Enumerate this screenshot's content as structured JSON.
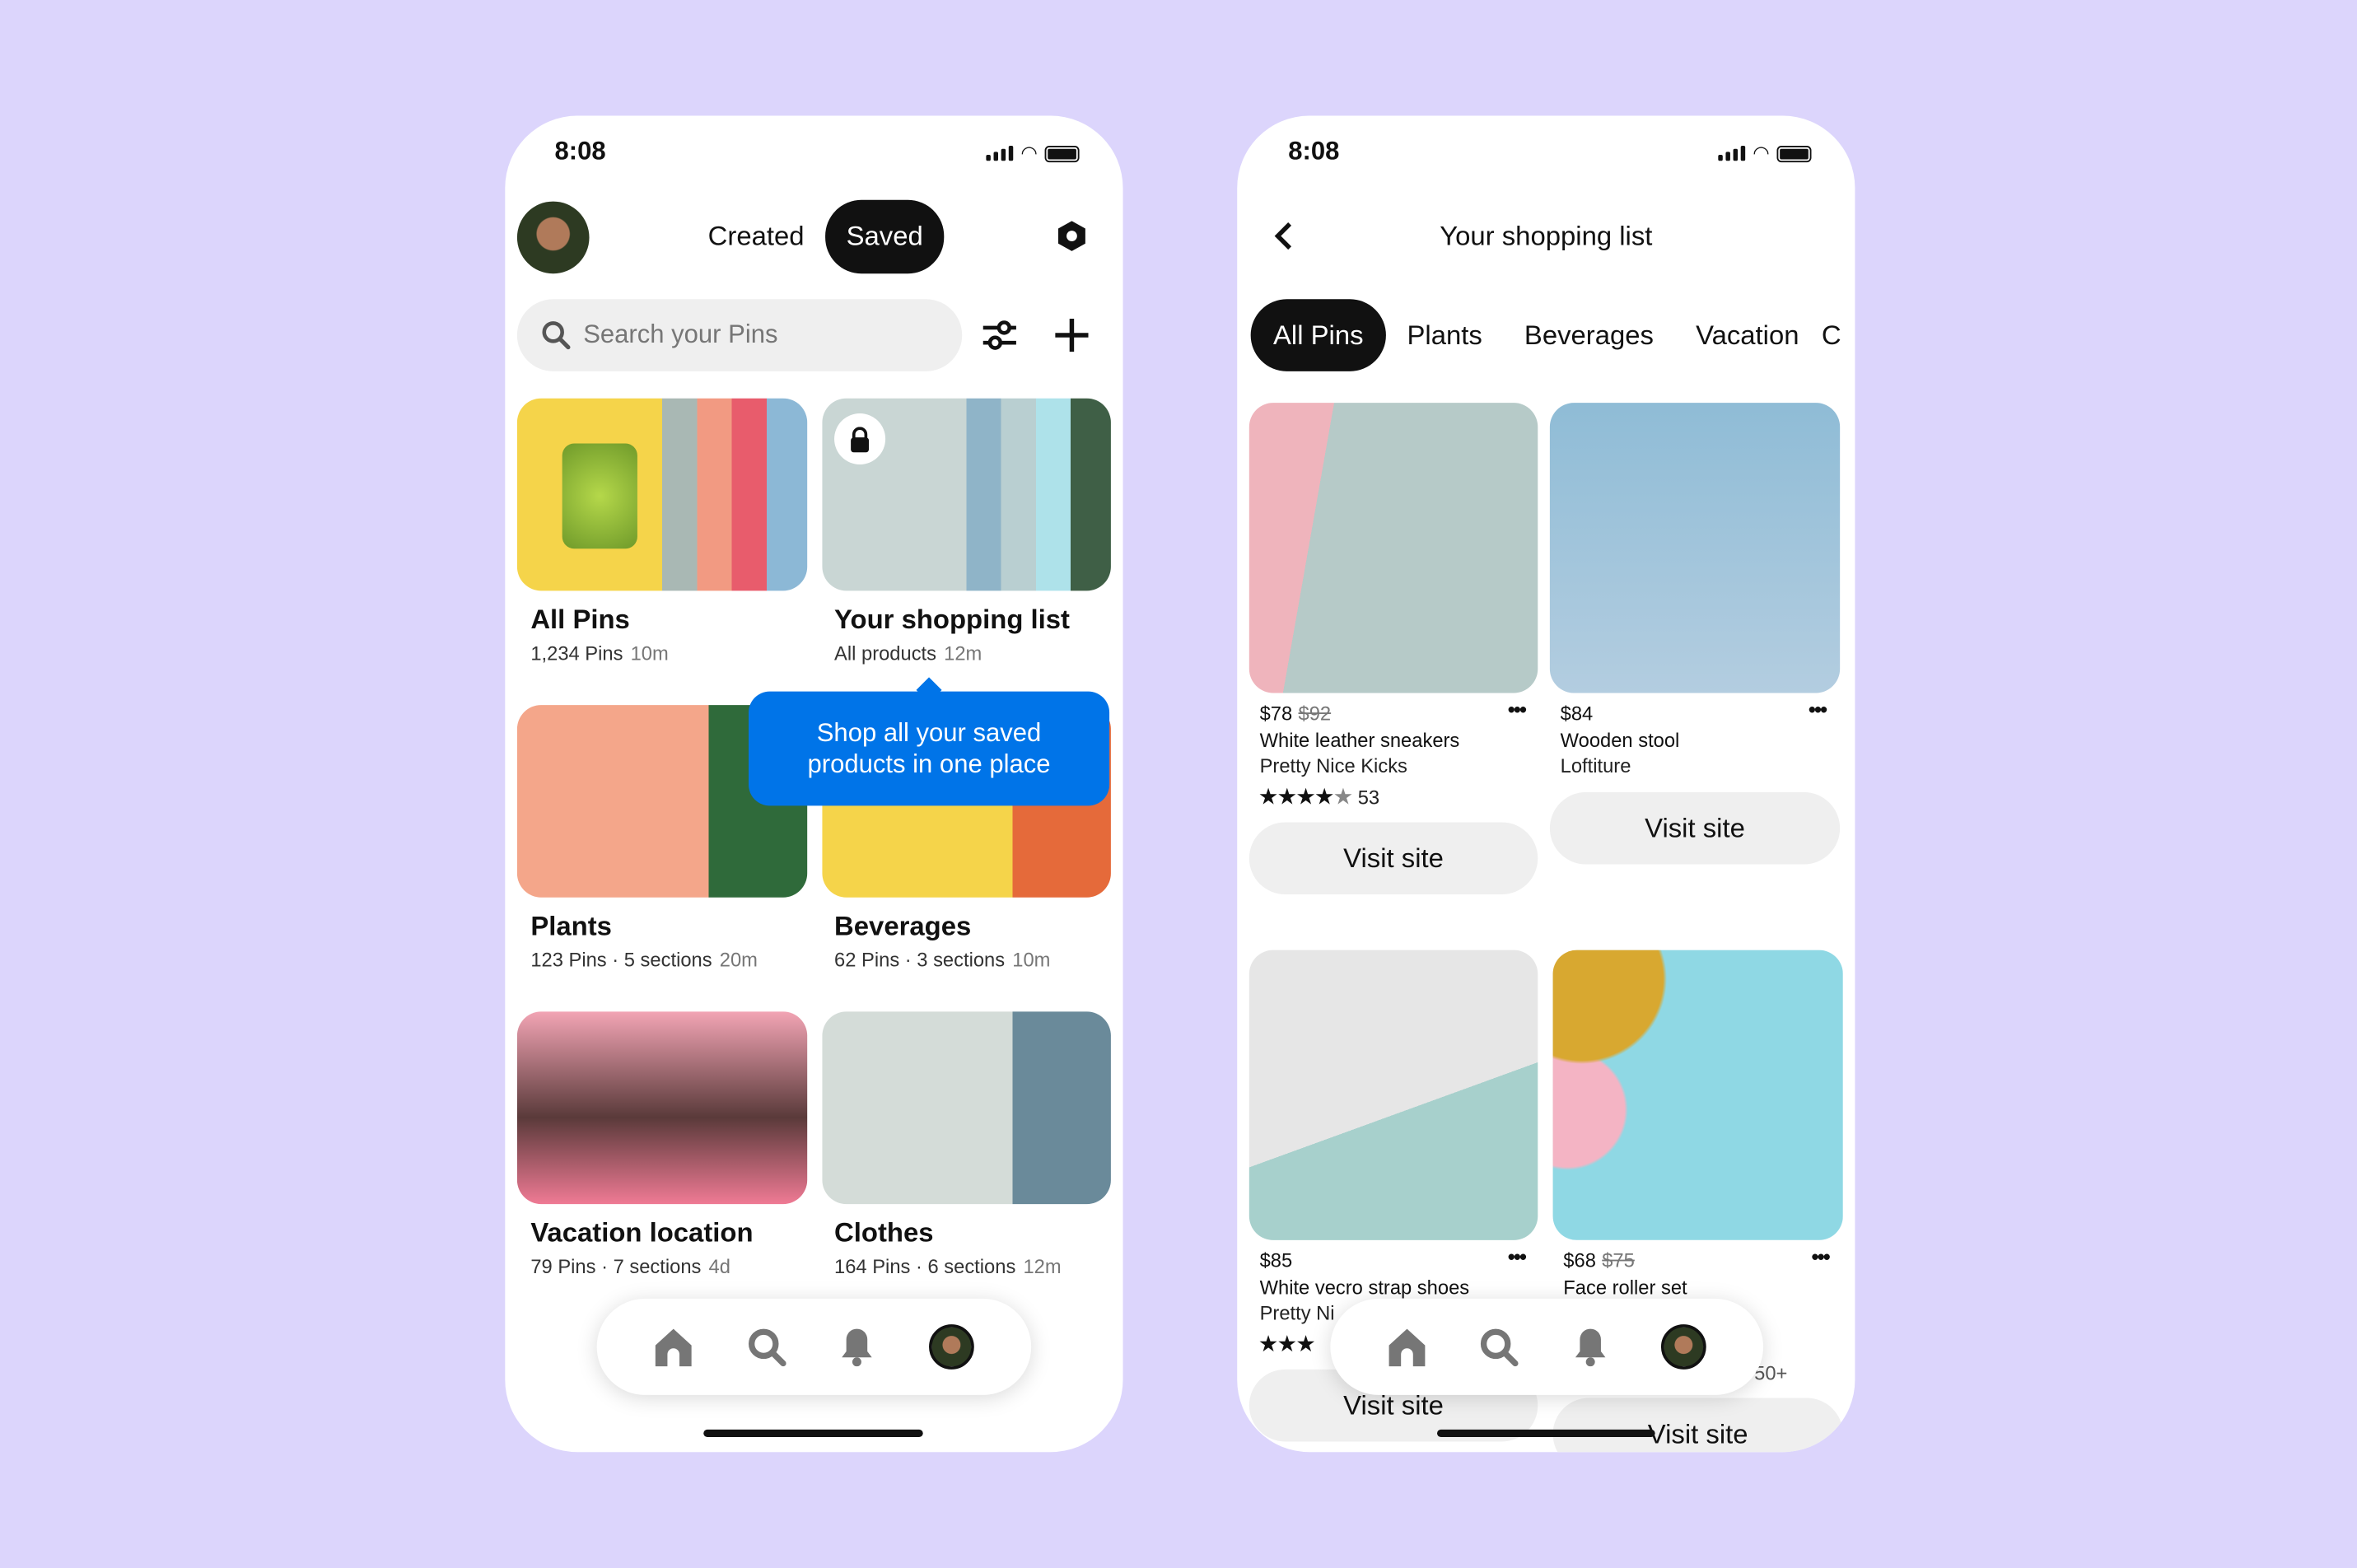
{
  "status": {
    "time": "8:08"
  },
  "colors": {
    "background": "#dcd5fc",
    "accent": "#0074e8",
    "dark": "#111111",
    "button_gray": "#efefef"
  },
  "profile": {
    "tabs": [
      {
        "label": "Created",
        "active": false
      },
      {
        "label": "Saved",
        "active": true
      }
    ],
    "settings_icon": "hexagon-gear-icon",
    "search": {
      "placeholder": "Search your Pins"
    },
    "boards": [
      {
        "title": "All Pins",
        "subtitle": "1,234 Pins",
        "time": "10m"
      },
      {
        "title": "Your shopping list",
        "subtitle": "All products",
        "time": "12m",
        "private": true
      },
      {
        "title": "Plants",
        "subtitle": "123 Pins · 5 sections",
        "time": "20m"
      },
      {
        "title": "Beverages",
        "subtitle": "62 Pins · 3 sections",
        "time": "10m"
      },
      {
        "title": "Vacation location",
        "subtitle": "79 Pins · 7 sections",
        "time": "4d"
      },
      {
        "title": "Clothes",
        "subtitle": "164 Pins · 6 sections",
        "time": "12m"
      }
    ],
    "tooltip": "Shop all your saved products in one place"
  },
  "shopping": {
    "title": "Your shopping list",
    "tabs": [
      {
        "label": "All Pins",
        "active": true
      },
      {
        "label": "Plants"
      },
      {
        "label": "Beverages"
      },
      {
        "label": "Vacation"
      },
      {
        "label": "C"
      }
    ],
    "products": [
      {
        "price": "$78",
        "old_price": "$92",
        "name": "White leather sneakers",
        "brand": "Pretty Nice Kicks",
        "rating": 4.5,
        "reviews": "53",
        "button": "Visit site"
      },
      {
        "price": "$84",
        "old_price": "",
        "name": "Wooden stool",
        "brand": "Loftiture",
        "button": "Visit site"
      },
      {
        "price": "$85",
        "old_price": "",
        "name": "White vecro strap shoes",
        "brand": "Pretty Ni",
        "rating": 3,
        "button": "Visit site"
      },
      {
        "price": "$68",
        "old_price": "$75",
        "name": "Face roller set",
        "reviews": "50+",
        "button": "Visit site"
      }
    ]
  },
  "nav": {
    "items": [
      "home-icon",
      "search-icon",
      "bell-icon",
      "avatar"
    ]
  }
}
